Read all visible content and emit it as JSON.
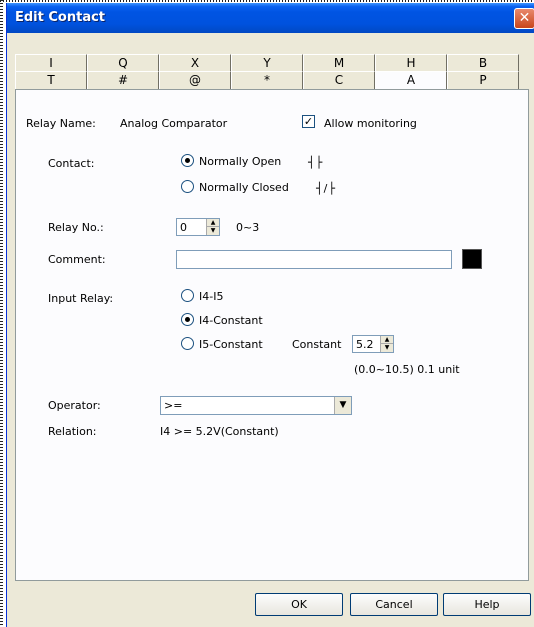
{
  "window": {
    "title": "Edit Contact",
    "close_glyph": "✕"
  },
  "tabs": {
    "row1": [
      "I",
      "Q",
      "X",
      "Y",
      "M",
      "H",
      "B"
    ],
    "row2": [
      "T",
      "#",
      "@",
      "*",
      "C",
      "A",
      "P"
    ],
    "active": "A"
  },
  "relay": {
    "name_label": "Relay Name:",
    "name_value": "Analog Comparator",
    "allow_monitoring_label": "Allow monitoring",
    "allow_monitoring_checked": true
  },
  "contact": {
    "label": "Contact:",
    "options": [
      {
        "label": "Normally Open",
        "symbol": "┤├",
        "checked": true
      },
      {
        "label": "Normally Closed",
        "symbol": "┤/├",
        "checked": false
      }
    ]
  },
  "relay_no": {
    "label": "Relay No.:",
    "value": "0",
    "range": "0~3"
  },
  "comment": {
    "label": "Comment:",
    "value": "",
    "color": "#000000"
  },
  "input_relay": {
    "label": "Input Relay:",
    "options": [
      {
        "label": "I4-I5",
        "checked": false
      },
      {
        "label": "I4-Constant",
        "checked": true
      },
      {
        "label": "I5-Constant",
        "checked": false
      }
    ],
    "constant_label": "Constant",
    "constant_value": "5.2",
    "constant_hint": "(0.0~10.5)  0.1 unit"
  },
  "operator": {
    "label": "Operator:",
    "value": ">="
  },
  "relation": {
    "label": "Relation:",
    "value": "I4 >= 5.2V(Constant)"
  },
  "buttons": {
    "ok": "OK",
    "cancel": "Cancel",
    "help": "Help"
  }
}
